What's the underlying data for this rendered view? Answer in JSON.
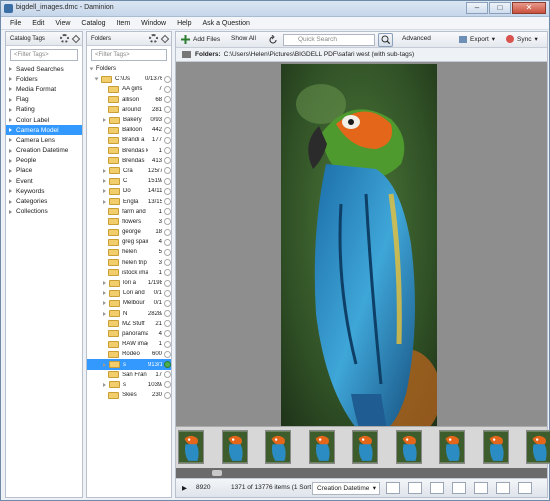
{
  "window": {
    "title": "bigdell_images.dmc - Daminion",
    "controls": [
      "–",
      "□",
      "✕"
    ]
  },
  "menu": [
    "File",
    "Edit",
    "View",
    "Catalog",
    "Item",
    "Window",
    "Help",
    "Ask a Question"
  ],
  "tags_panel": {
    "header": "Catalog Tags",
    "filter_placeholder": "<Filter Tags>",
    "items": [
      {
        "label": "Saved Searches"
      },
      {
        "label": "Folders"
      },
      {
        "label": "Media Format"
      },
      {
        "label": "Flag"
      },
      {
        "label": "Rating"
      },
      {
        "label": "Color Label"
      },
      {
        "label": "Camera Model",
        "selected": true
      },
      {
        "label": "Camera Lens"
      },
      {
        "label": "Creation Datetime"
      },
      {
        "label": "People"
      },
      {
        "label": "Place"
      },
      {
        "label": "Event"
      },
      {
        "label": "Keywords"
      },
      {
        "label": "Categories"
      },
      {
        "label": "Collections"
      }
    ]
  },
  "folders_panel": {
    "header": "Folders",
    "filter_placeholder": "<Filter Tags>",
    "root_label": "Folders",
    "drive": {
      "name": "C:\\Us",
      "count": "0/13766"
    },
    "rows": [
      {
        "name": "AA girls",
        "count": "7",
        "exp": false
      },
      {
        "name": "allison",
        "count": "68",
        "exp": false
      },
      {
        "name": "around",
        "count": "281",
        "exp": false
      },
      {
        "name": "Bakery",
        "count": "0/93",
        "exp": true
      },
      {
        "name": "Balloon",
        "count": "442",
        "exp": false
      },
      {
        "name": "Brandi a",
        "count": "177",
        "exp": false
      },
      {
        "name": "Brendas ki",
        "count": "1",
        "exp": false
      },
      {
        "name": "Brendas",
        "count": "413",
        "exp": false
      },
      {
        "name": "Cra",
        "count": "125/780",
        "exp": true
      },
      {
        "name": "C",
        "count": "1519/1547",
        "exp": true
      },
      {
        "name": "Do",
        "count": "14/1107",
        "exp": true
      },
      {
        "name": "Engla",
        "count": "13/15",
        "exp": true
      },
      {
        "name": "farm and",
        "count": "1",
        "exp": false
      },
      {
        "name": "flowers",
        "count": "3",
        "exp": false
      },
      {
        "name": "george",
        "count": "18",
        "exp": false
      },
      {
        "name": "greg spain",
        "count": "4",
        "exp": false
      },
      {
        "name": "helen",
        "count": "5",
        "exp": false
      },
      {
        "name": "helen trip",
        "count": "3",
        "exp": false
      },
      {
        "name": "istock ima",
        "count": "1",
        "exp": false
      },
      {
        "name": "lori a",
        "count": "1/198",
        "exp": true
      },
      {
        "name": "Lori and",
        "count": "0/1",
        "exp": true
      },
      {
        "name": "Melbour",
        "count": "0/1",
        "exp": true
      },
      {
        "name": "N",
        "count": "2828/4377",
        "exp": true
      },
      {
        "name": "MZ Stuff",
        "count": "21",
        "exp": false
      },
      {
        "name": "panorama",
        "count": "4",
        "exp": false
      },
      {
        "name": "RAW imag",
        "count": "1",
        "exp": false
      },
      {
        "name": "Rodeo",
        "count": "600",
        "exp": false
      },
      {
        "name": "s",
        "count": "913/1371",
        "exp": true,
        "selected": true
      },
      {
        "name": "San Fran",
        "count": "17",
        "exp": false
      },
      {
        "name": "s",
        "count": "1039/2019",
        "exp": true
      },
      {
        "name": "Skies",
        "count": "230",
        "exp": false
      }
    ]
  },
  "toolbar": {
    "add_files": "Add Files",
    "show_all": "Show All",
    "search_placeholder": "Quick Search",
    "advanced": "Advanced",
    "export": "Export",
    "sync": "Sync"
  },
  "path": {
    "label": "Folders:",
    "value": "C:\\Users\\Helen\\Pictures\\BIGDELL PDF\\safari west (with sub-tags)"
  },
  "filmstrip": {
    "thumbnail_count": 9
  },
  "status": {
    "zoom": "8920",
    "items": "1371 of 13776 items (1 Sort By:",
    "sort_value": "Creation Datetime"
  },
  "colors": {
    "selection": "#3399ff",
    "viewer_bg": "#8e8e8e",
    "folder": "#f2cd6b"
  }
}
